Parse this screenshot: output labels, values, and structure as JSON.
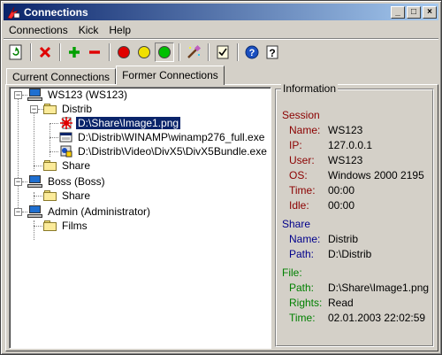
{
  "window": {
    "title": "Connections"
  },
  "title_buttons": {
    "minimize": "_",
    "maximize": "□",
    "close": "×"
  },
  "menu": [
    {
      "label": "Connections",
      "accel": "C"
    },
    {
      "label": "Kick",
      "accel": "K"
    },
    {
      "label": "Help",
      "accel": "H"
    }
  ],
  "toolbar": [
    {
      "icon": "refresh-icon"
    },
    {
      "icon": "delete-icon"
    },
    {
      "icon": "add-icon"
    },
    {
      "icon": "remove-icon"
    },
    {
      "icon": "red-light-icon",
      "color": "#e00000"
    },
    {
      "icon": "yellow-light-icon",
      "color": "#f0e000"
    },
    {
      "icon": "green-light-icon",
      "color": "#00c000"
    },
    {
      "icon": "wand-icon"
    },
    {
      "icon": "checklist-icon"
    },
    {
      "icon": "help-icon"
    },
    {
      "icon": "context-help-icon"
    }
  ],
  "tabs": [
    {
      "label": "Current Connections",
      "active": false
    },
    {
      "label": "Former Connections",
      "active": true
    }
  ],
  "tree": {
    "ws123": "WS123 (WS123)",
    "distrib": "Distrib",
    "file1": "D:\\Share\\Image1.png",
    "file2": "D:\\Distrib\\WINAMP\\winamp276_full.exe",
    "file3": "D:\\Distrib\\Video\\DivX5\\DivX5Bundle.exe",
    "share1": "Share",
    "boss": "Boss (Boss)",
    "share2": "Share",
    "admin": "Admin (Administrator)",
    "films": "Films"
  },
  "info": {
    "group_title": "Information",
    "session": {
      "title": "Session",
      "name_k": "Name:",
      "name_v": "WS123",
      "ip_k": "IP:",
      "ip_v": "127.0.0.1",
      "user_k": "User:",
      "user_v": "WS123",
      "os_k": "OS:",
      "os_v": "Windows 2000 2195",
      "time_k": "Time:",
      "time_v": "00:00",
      "idle_k": "Idle:",
      "idle_v": "00:00"
    },
    "share": {
      "title": "Share",
      "name_k": "Name:",
      "name_v": "Distrib",
      "path_k": "Path:",
      "path_v": "D:\\Distrib"
    },
    "file": {
      "title": "File:",
      "path_k": "Path:",
      "path_v": "D:\\Share\\Image1.png",
      "rights_k": "Rights:",
      "rights_v": "Read",
      "time_k": "Time:",
      "time_v": "02.01.2003 22:02:59"
    }
  },
  "colors": {
    "session": "#8b0000",
    "share": "#00008b",
    "file": "#008000",
    "selection": "#0a246a"
  }
}
